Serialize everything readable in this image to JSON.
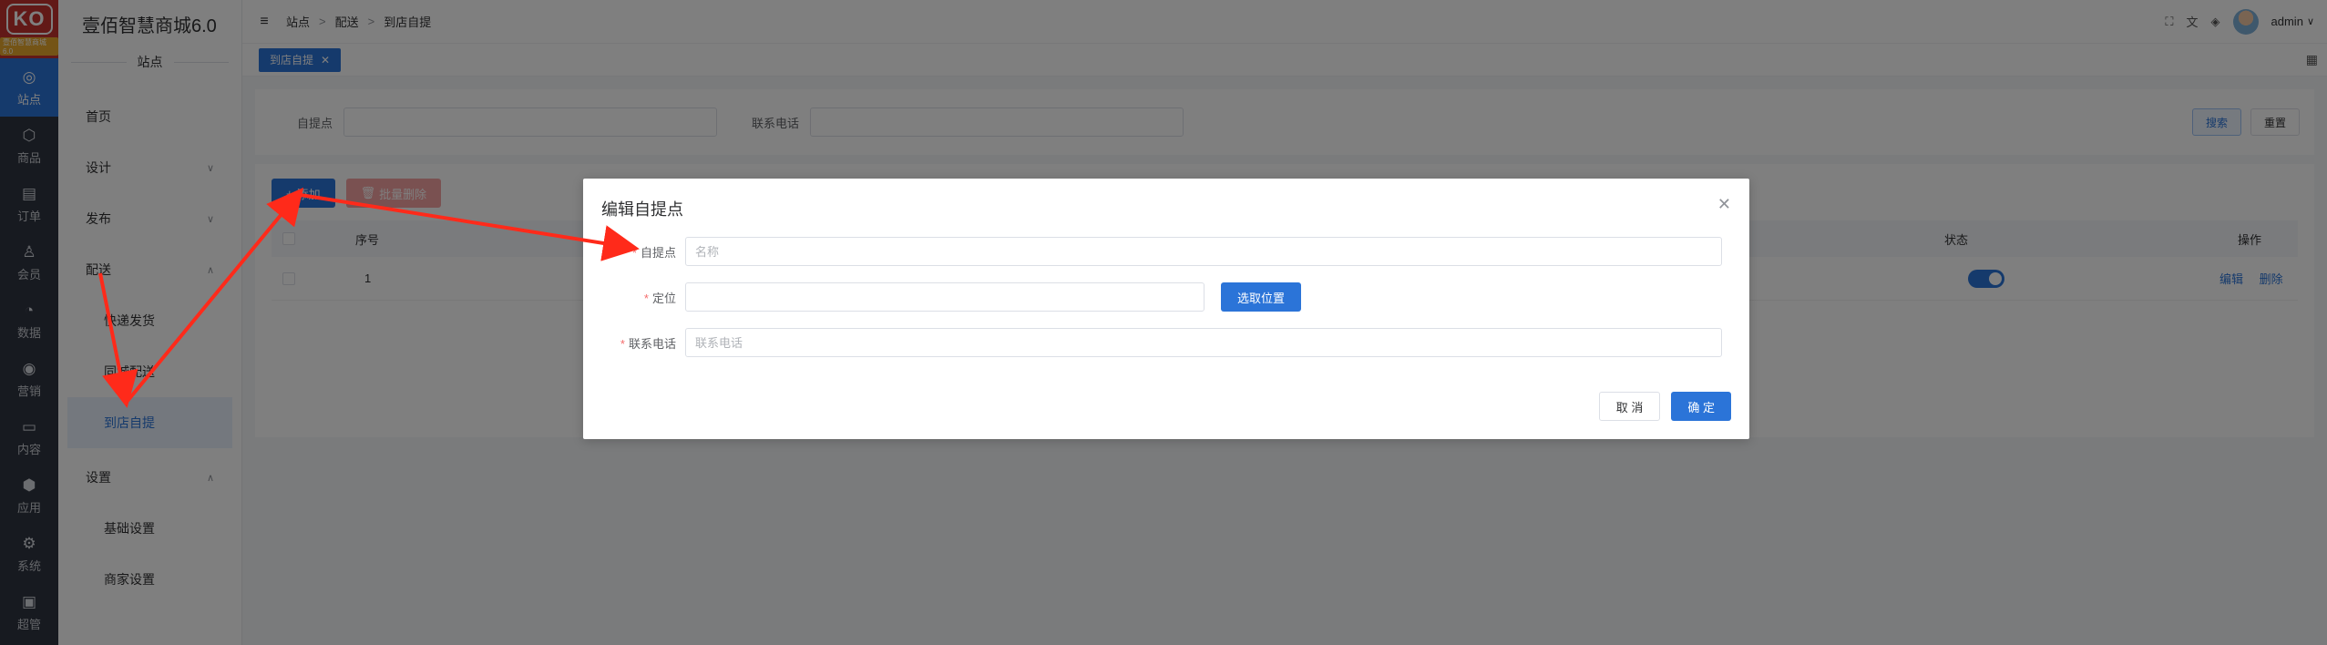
{
  "brand": {
    "logo_text": "KO",
    "logo_tag": "壹佰智慧商城6.0",
    "title": "壹佰智慧商城6.0"
  },
  "rail": [
    {
      "label": "站点",
      "icon": "globe-icon",
      "glyph": "◎"
    },
    {
      "label": "商品",
      "icon": "box-icon",
      "glyph": "⬡"
    },
    {
      "label": "订单",
      "icon": "clipboard-icon",
      "glyph": "▤"
    },
    {
      "label": "会员",
      "icon": "user-icon",
      "glyph": "♙"
    },
    {
      "label": "数据",
      "icon": "chart-pie-icon",
      "glyph": "◔"
    },
    {
      "label": "营销",
      "icon": "target-icon",
      "glyph": "◉"
    },
    {
      "label": "内容",
      "icon": "folder-icon",
      "glyph": "▭"
    },
    {
      "label": "应用",
      "icon": "cube-icon",
      "glyph": "⬢"
    },
    {
      "label": "系统",
      "icon": "gear-icon",
      "glyph": "⚙"
    },
    {
      "label": "超管",
      "icon": "briefcase-icon",
      "glyph": "▣"
    }
  ],
  "sidebar": {
    "group": "站点",
    "items": [
      {
        "label": "首页"
      },
      {
        "label": "设计"
      },
      {
        "label": "发布"
      },
      {
        "label": "配送"
      },
      {
        "label": "快递发货"
      },
      {
        "label": "同城配送"
      },
      {
        "label": "到店自提"
      },
      {
        "label": "设置"
      },
      {
        "label": "基础设置"
      },
      {
        "label": "商家设置"
      }
    ]
  },
  "header": {
    "breadcrumb": [
      "站点",
      "配送",
      "到店自提"
    ],
    "user": "admin"
  },
  "tabs": [
    {
      "label": "到店自提"
    }
  ],
  "filter": {
    "label_pickup": "自提点",
    "label_phone": "联系电话",
    "search": "搜索",
    "reset": "重置"
  },
  "table": {
    "add": "添加",
    "batch_delete": "批量删除",
    "columns": {
      "index": "序号",
      "status": "状态",
      "ops": "操作"
    },
    "rows": [
      {
        "index": "1",
        "edit": "编辑",
        "delete": "删除"
      }
    ]
  },
  "dialog": {
    "title": "编辑自提点",
    "pickup_label": "自提点",
    "pickup_placeholder": "名称",
    "location_label": "定位",
    "pick_location": "选取位置",
    "phone_label": "联系电话",
    "phone_placeholder": "联系电话",
    "cancel": "取 消",
    "confirm": "确 定"
  },
  "colors": {
    "accent": "#2b74d8",
    "annotation": "#ff2a1a",
    "required": "#f56c6c"
  }
}
